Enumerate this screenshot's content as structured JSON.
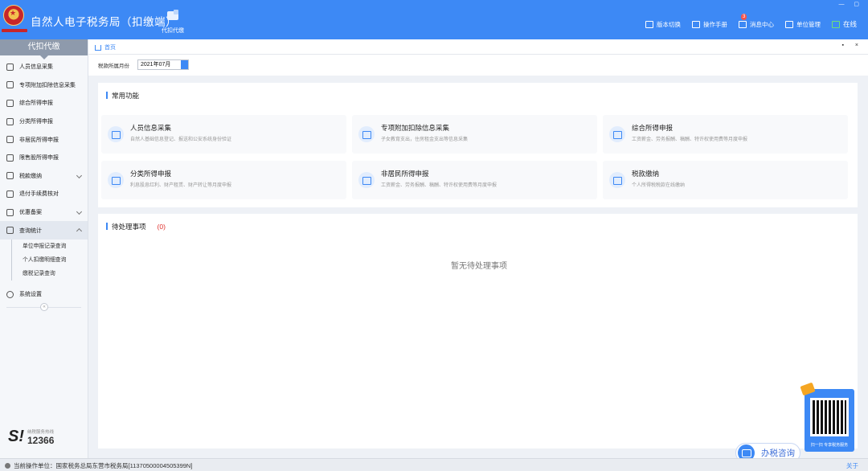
{
  "app": {
    "title": "自然人电子税务局（扣缴端）",
    "top_tab": "代扣代缴",
    "actions": [
      {
        "label": "版本切换",
        "icon": "switch-icon"
      },
      {
        "label": "操作手册",
        "icon": "manual-icon"
      },
      {
        "label": "消息中心",
        "icon": "message-icon",
        "badge": "3"
      },
      {
        "label": "单位管理",
        "icon": "building-icon"
      },
      {
        "label": "在线",
        "icon": "online-icon"
      }
    ],
    "window_controls": "— ▢"
  },
  "sidebar": {
    "header": "代扣代缴",
    "items": [
      {
        "label": "人员信息采集",
        "icon": "person-icon"
      },
      {
        "label": "专项附加扣除信息采集",
        "icon": "list-icon"
      },
      {
        "label": "综合所得申报",
        "icon": "layers-icon"
      },
      {
        "label": "分类所得申报",
        "icon": "pie-icon"
      },
      {
        "label": "非居民所得申报",
        "icon": "nonresident-icon"
      },
      {
        "label": "限售股所得申报",
        "icon": "stock-icon"
      },
      {
        "label": "税款缴纳",
        "icon": "payment-icon",
        "expandable": true
      },
      {
        "label": "退付手续费核对",
        "icon": "refund-icon"
      },
      {
        "label": "优惠备案",
        "icon": "discount-icon",
        "expandable": true
      },
      {
        "label": "查询统计",
        "icon": "query-icon",
        "expandable": true,
        "expanded": true
      }
    ],
    "sub_items": [
      "单位申报记录查询",
      "个人扣缴明细查询",
      "缴税记录查询"
    ],
    "settings": {
      "label": "系统设置",
      "icon": "gear-icon"
    },
    "collapse": "«",
    "hotline_label": "纳税服务热线",
    "hotline_number": "12366"
  },
  "breadcrumb": {
    "home": "首页",
    "controls": "▪ ×"
  },
  "period": {
    "label": "税款所属月份",
    "value": "2021年07月"
  },
  "common": {
    "title": "常用功能",
    "functions": [
      {
        "name": "人员信息采集",
        "desc": "自然人基础信息登记、报送和公安系统身份验证",
        "icon": "id-card-icon"
      },
      {
        "name": "专项附加扣除信息采集",
        "desc": "子女教育支出，住房租金支出等信息采集",
        "icon": "deduction-icon"
      },
      {
        "name": "综合所得申报",
        "desc": "工资薪金、劳务报酬、稿酬、特许权使用费等月度申报",
        "icon": "report-icon"
      },
      {
        "name": "分类所得申报",
        "desc": "利息股息红利、财产租赁、财产转让等月度申报",
        "icon": "edit-icon"
      },
      {
        "name": "非居民所得申报",
        "desc": "工资薪金、劳务报酬、稿酬、特许权使用费等月度申报",
        "icon": "edit-icon"
      },
      {
        "name": "税款缴纳",
        "desc": "个人所得税税款在线缴纳",
        "icon": "tax-pay-icon"
      }
    ]
  },
  "pending": {
    "title": "待处理事项",
    "count": "(0)",
    "empty": "暂无待处理事项"
  },
  "status": {
    "unit": "当前操作单位：国家税务总局东营市税务局[11370500004505399N]",
    "about": "关于"
  },
  "widgets": {
    "chat": "办税咨询",
    "qr_caption": "扫一扫 专享税务服务"
  }
}
